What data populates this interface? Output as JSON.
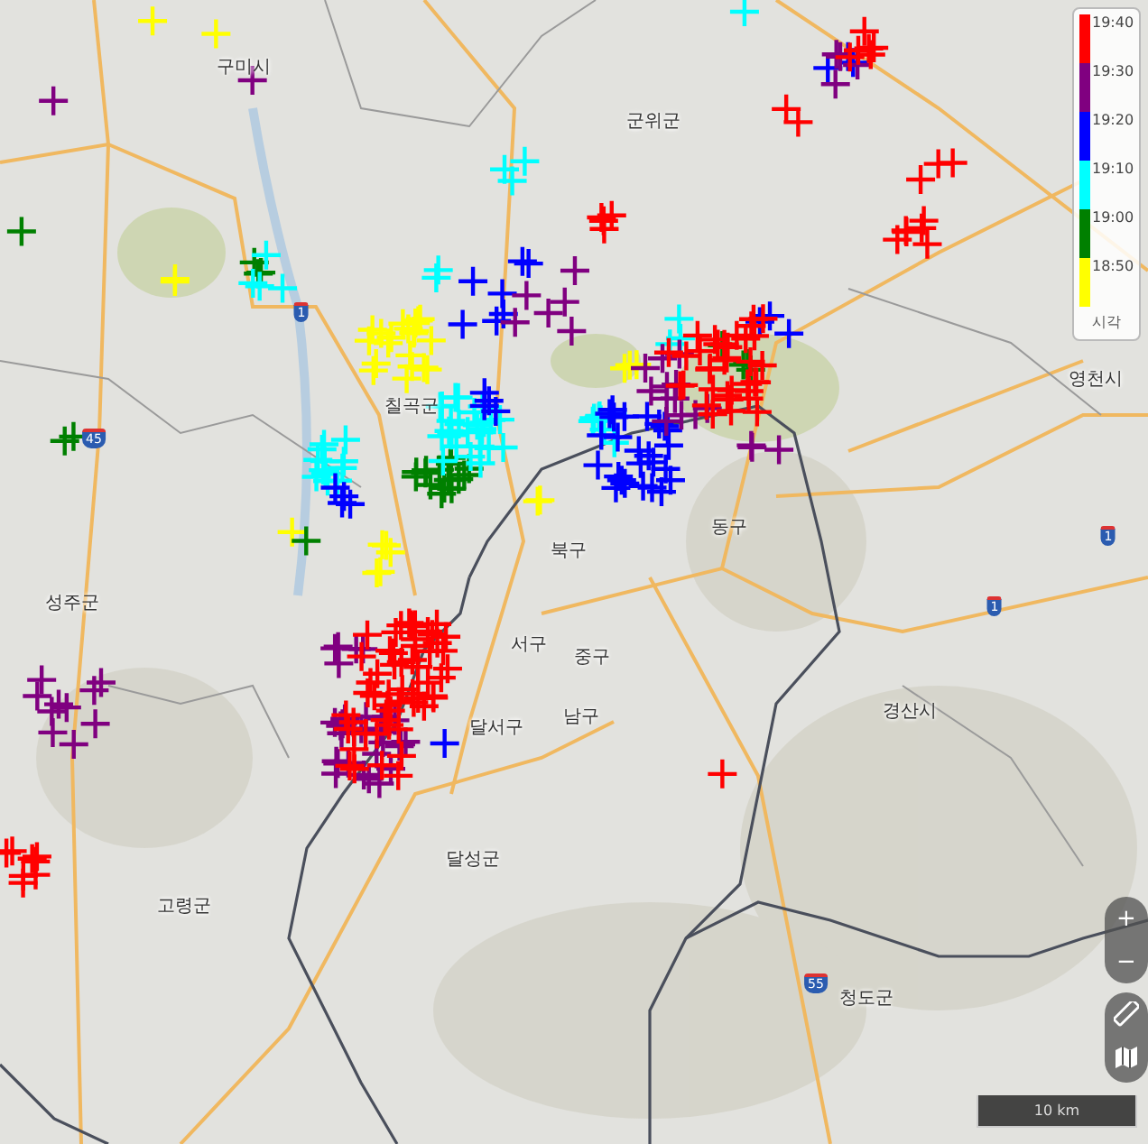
{
  "map": {
    "place_labels": [
      {
        "kind": "place",
        "text": "구미시"
      },
      {
        "kind": "place",
        "text": "군위군"
      },
      {
        "kind": "place",
        "text": "칠곡군"
      },
      {
        "kind": "place",
        "text": "영천시"
      },
      {
        "kind": "place",
        "text": "성주군"
      },
      {
        "kind": "place",
        "text": "북구"
      },
      {
        "kind": "place",
        "text": "동구"
      },
      {
        "kind": "place",
        "text": "서구"
      },
      {
        "kind": "place",
        "text": "중구"
      },
      {
        "kind": "place",
        "text": "남구"
      },
      {
        "kind": "place",
        "text": "달서구"
      },
      {
        "kind": "place",
        "text": "경산시"
      },
      {
        "kind": "place",
        "text": "달성군"
      },
      {
        "kind": "place",
        "text": "고령군"
      },
      {
        "kind": "place",
        "text": "청도군"
      },
      {
        "kind": "shield",
        "text": "1"
      },
      {
        "kind": "shield",
        "text": "45"
      },
      {
        "kind": "shield",
        "text": "1"
      },
      {
        "kind": "shield",
        "text": "1"
      },
      {
        "kind": "shield",
        "text": "55"
      }
    ]
  },
  "legend": {
    "items": [
      {
        "label": "19:40",
        "color": "#ff0000"
      },
      {
        "label": "19:30",
        "color": "#800080"
      },
      {
        "label": "19:20",
        "color": "#0000ff"
      },
      {
        "label": "19:10",
        "color": "#00ffff"
      },
      {
        "label": "19:00",
        "color": "#008000"
      },
      {
        "label": "18:50",
        "color": "#ffff00"
      }
    ],
    "title": "시각"
  },
  "controls": {
    "zoom_in": "+",
    "zoom_out": "−"
  },
  "scale_bar": {
    "label": "10 km"
  }
}
